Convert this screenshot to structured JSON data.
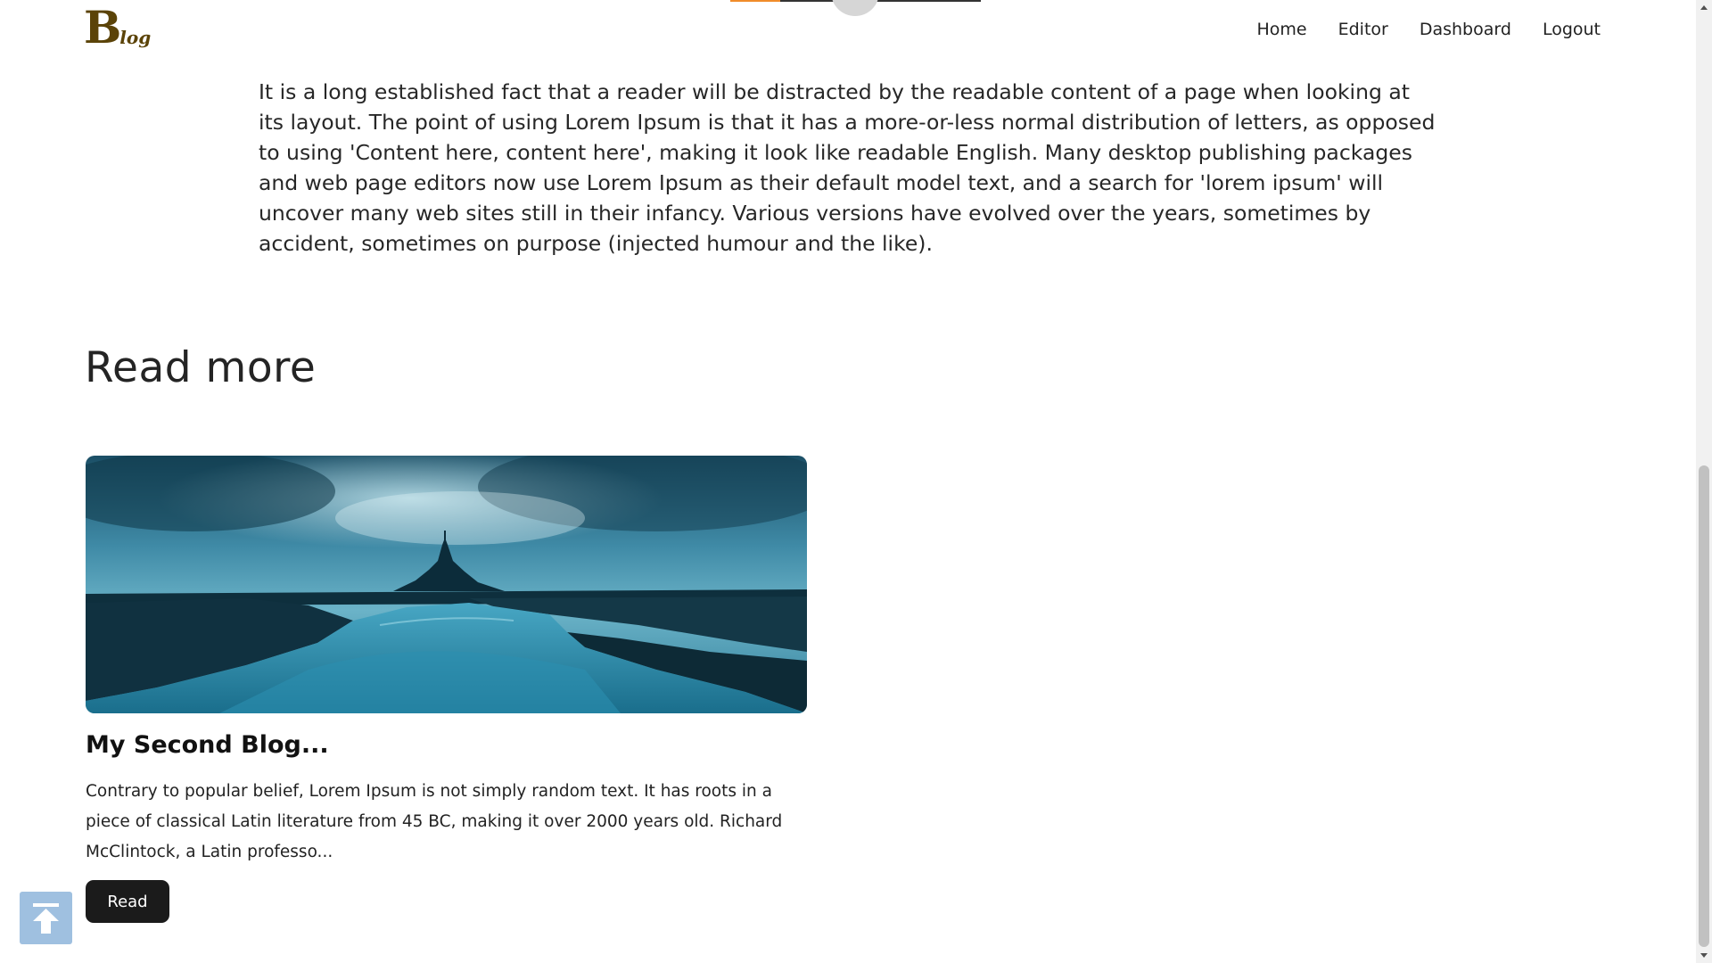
{
  "header": {
    "logo_big": "B",
    "logo_small": "log",
    "nav": [
      "Home",
      "Editor",
      "Dashboard",
      "Logout"
    ]
  },
  "reading_progress_fraction": 0.2,
  "article": {
    "body": "It is a long established fact that a reader will be distracted by the readable content of a page when looking at its layout. The point of using Lorem Ipsum is that it has a more-or-less normal distribution of letters, as opposed to using 'Content here, content here', making it look like readable English. Many desktop publishing packages and web page editors now use Lorem Ipsum as their default model text, and a search for 'lorem ipsum' will uncover many web sites still in their infancy. Various versions have evolved over the years, sometimes by accident, sometimes on purpose (injected humour and the like)."
  },
  "read_more": {
    "heading": "Read more",
    "cards": [
      {
        "title": "My Second Blog...",
        "excerpt": "Contrary to popular belief, Lorem Ipsum is not simply random text. It has roots in a piece of classical Latin literature from 45 BC, making it over 2000 years old. Richard McClintock, a Latin professo...",
        "button": "Read"
      }
    ]
  },
  "icons": {
    "back_to_top": "arrow-up-to-line-icon"
  },
  "colors": {
    "logo": "#5b4308",
    "progress_fill": "#f08c2a",
    "button_bg": "#1b1b1b",
    "back_to_top_bg": "#9fc0e0"
  }
}
